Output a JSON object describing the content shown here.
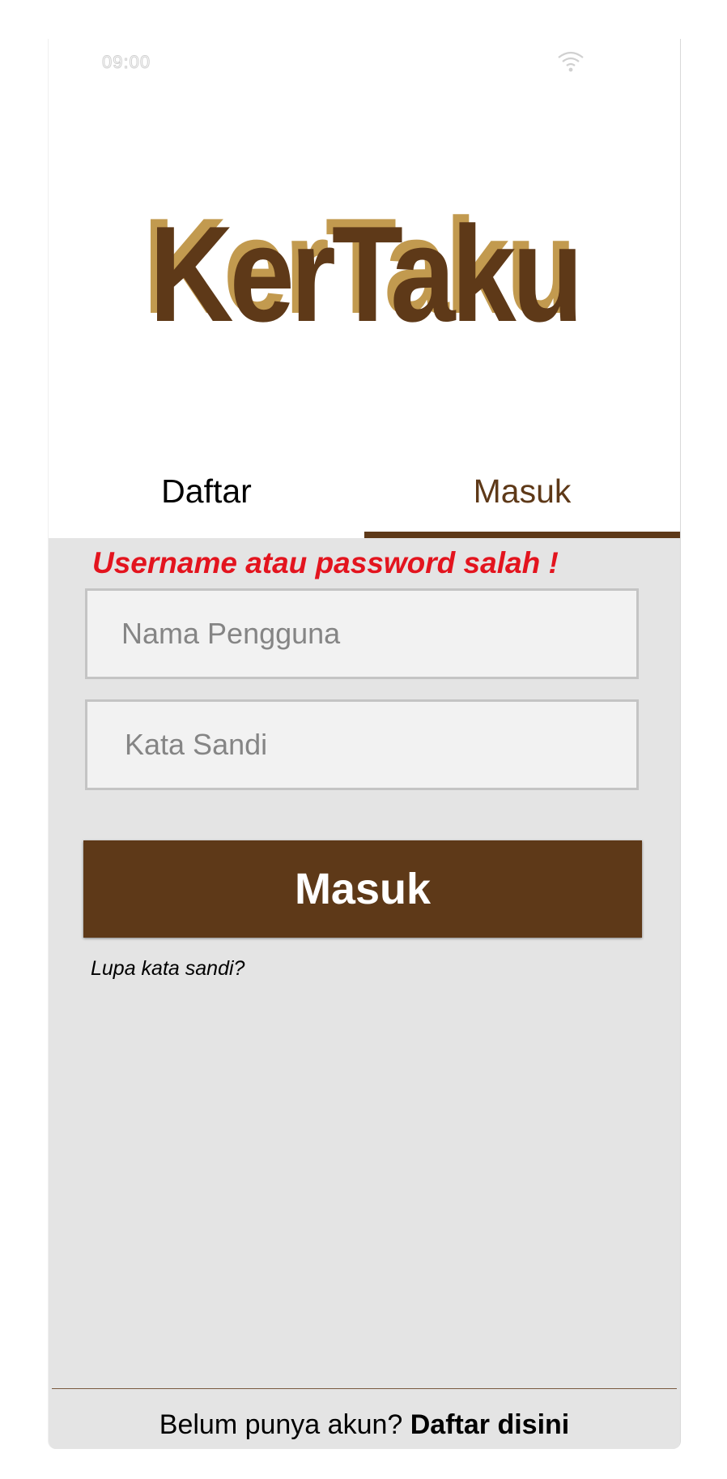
{
  "status_bar": {
    "time": "09:00",
    "wifi_icon": "wifi-icon"
  },
  "app": {
    "logo_text": "KerTaku",
    "colors": {
      "brand_brown": "#5e3918",
      "logo_shadow": "#c29a4f",
      "error_red": "#e3141e",
      "panel_gray": "#e4e4e4"
    }
  },
  "tabs": [
    {
      "label": "Daftar",
      "active": false
    },
    {
      "label": "Masuk",
      "active": true
    }
  ],
  "login_form": {
    "error_message": "Username atau password salah !",
    "username_placeholder": "Nama Pengguna",
    "username_value": "",
    "password_placeholder": "Kata Sandi",
    "password_value": "",
    "submit_label": "Masuk",
    "forgot_label": "Lupa kata sandi?"
  },
  "footer": {
    "prompt": "Belum punya akun? ",
    "link": "Daftar disini"
  }
}
